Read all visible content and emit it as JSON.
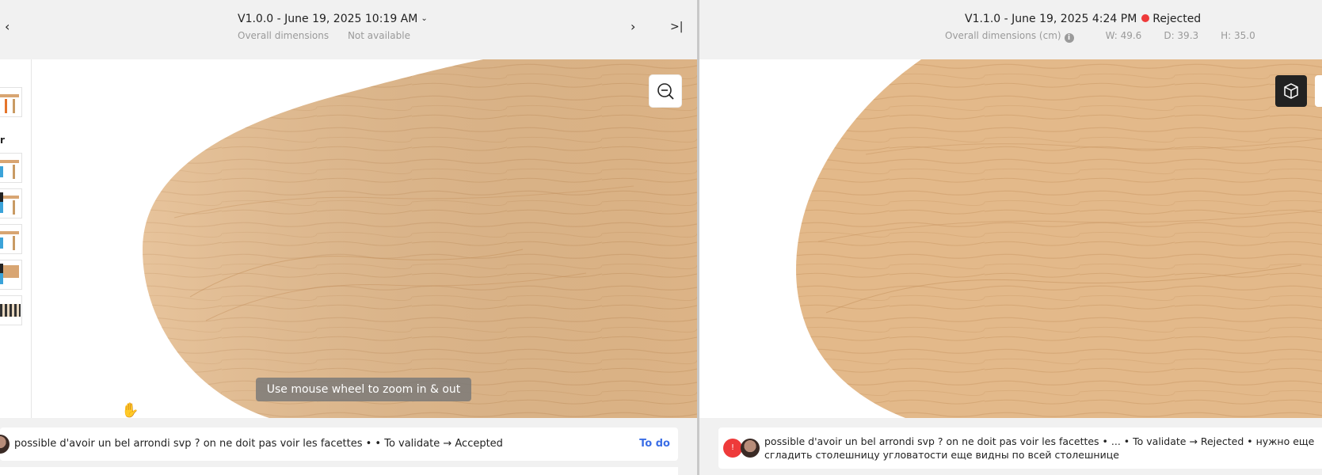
{
  "left": {
    "version_title": "V1.0.0 - June 19, 2025 10:19 AM",
    "dims_label": "Overall dimensions",
    "dims_value": "Not available",
    "thumb_label": "r",
    "hint": "Use mouse wheel to zoom in & out",
    "comment": {
      "text": "possible d'avoir un bel arrondi svp ? on ne doit pas voir les facettes • • To validate → Accepted",
      "status": "To do"
    }
  },
  "right": {
    "version_title": "V1.1.0 - June 19, 2025 4:24 PM",
    "status": "Rejected",
    "status_color": "#ee3a3a",
    "dims_label": "Overall dimensions (cm)",
    "dim_w": "W: 49.6",
    "dim_d": "D: 39.3",
    "dim_h": "H: 35.0",
    "comment": {
      "badge": "!",
      "line1": "possible d'avoir un bel arrondi svp ? on ne doit pas voir les facettes • ... • To validate → Rejected • нужно еще",
      "line2": "сгладить столешницу угловатости еще видны по всей столешнице"
    }
  },
  "icons": {
    "prev": "chevron-left-icon",
    "next": "chevron-right-icon",
    "last": "skip-to-end-icon",
    "zoom": "zoom-out-icon",
    "cube": "cube-3d-icon",
    "info": "info-icon",
    "hand": "hand-cursor-icon"
  },
  "colors": {
    "wood": "#e3b98a",
    "accent_link": "#3b6ee6",
    "rejected": "#ee3a3a"
  }
}
